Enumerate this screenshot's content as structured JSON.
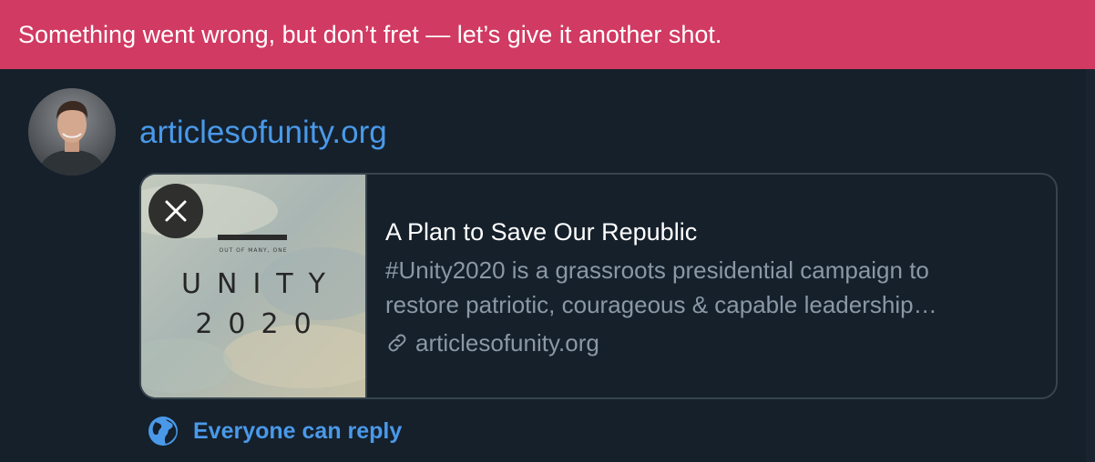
{
  "error_banner": {
    "message": "Something went wrong, but don’t fret — let’s give it another shot.",
    "color": "#d13a62"
  },
  "tweet": {
    "text": "articlesofunity.org",
    "link_color": "#4a99e9"
  },
  "card": {
    "image_text_line1": "UNITY",
    "image_text_line2": "2020",
    "image_tagline": "OUT OF MANY, ONE",
    "close_icon": "close-icon",
    "title": "A Plan to Save Our Republic",
    "description_line1": "#Unity2020 is a grassroots presidential campaign to",
    "description_line2": "restore patriotic, courageous & capable leadership…",
    "link_icon": "link-icon",
    "domain": "articlesofunity.org"
  },
  "reply_settings": {
    "icon": "globe-icon",
    "label": "Everyone can reply"
  },
  "colors": {
    "background": "#15202b",
    "border": "#38444d",
    "secondary_text": "#8b98a5"
  }
}
